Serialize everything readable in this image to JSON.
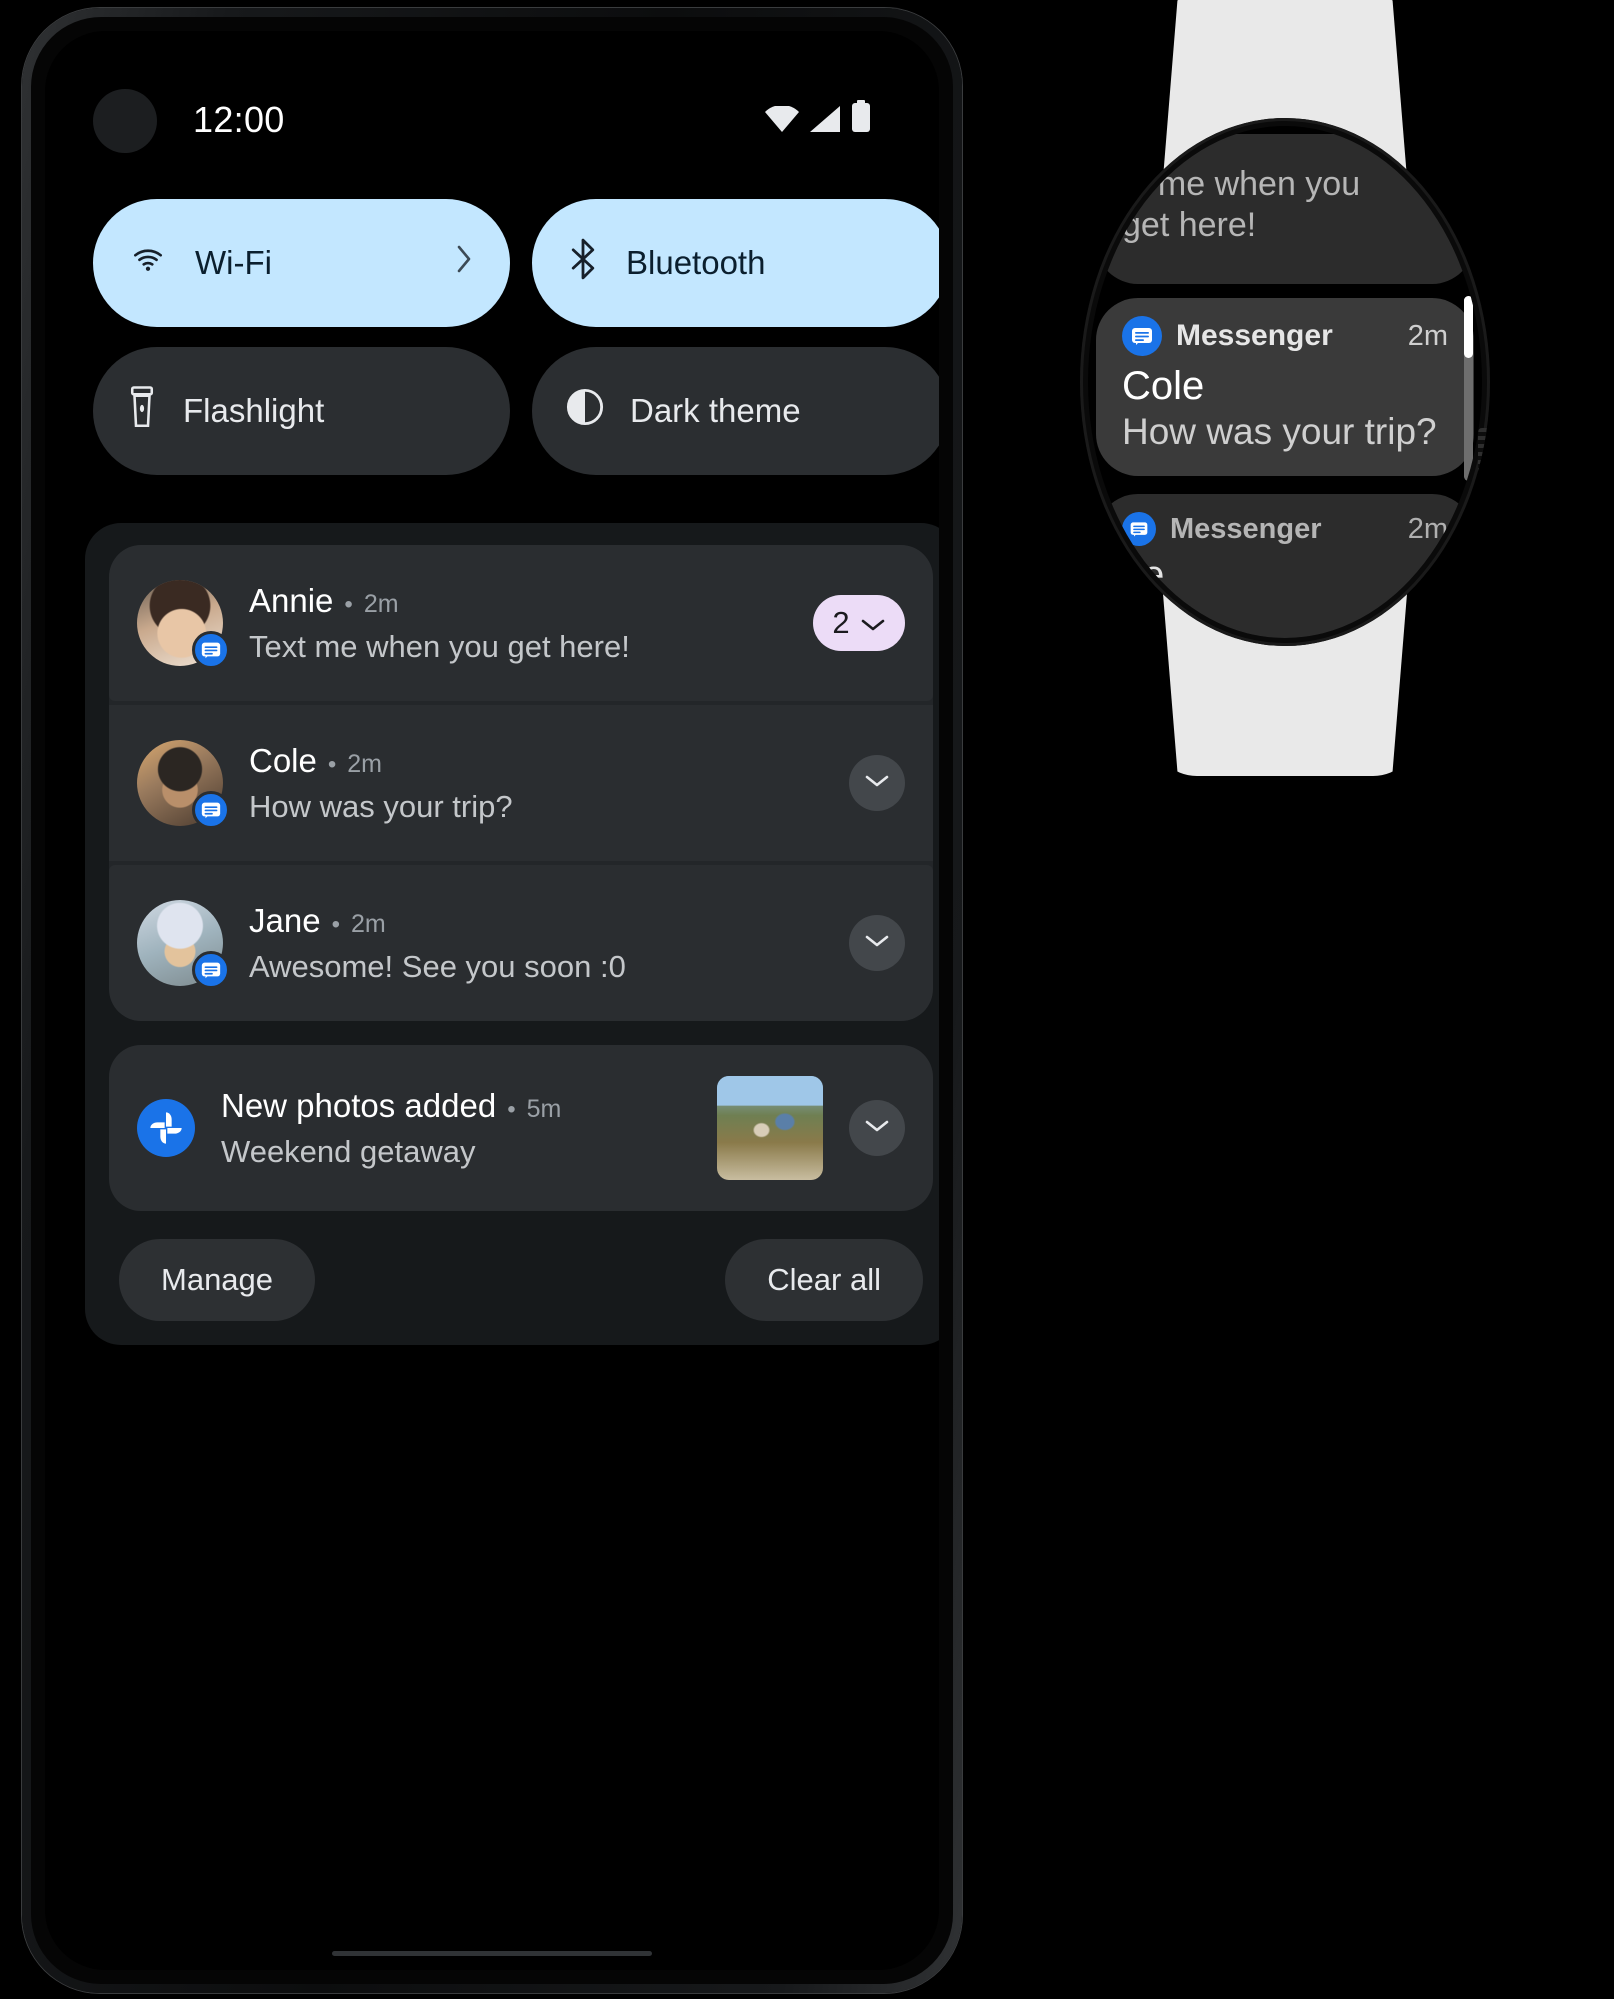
{
  "phone": {
    "status_bar": {
      "time": "12:00",
      "icons": [
        "wifi-icon",
        "cell-signal-icon",
        "battery-icon"
      ]
    },
    "quick_tiles": [
      {
        "label": "Wi-Fi",
        "icon": "wifi-icon",
        "state": "on",
        "has_chevron": true
      },
      {
        "label": "Bluetooth",
        "icon": "bluetooth-icon",
        "state": "on",
        "has_chevron": false
      },
      {
        "label": "Flashlight",
        "icon": "flashlight-icon",
        "state": "off",
        "has_chevron": false
      },
      {
        "label": "Dark theme",
        "icon": "dark-theme-icon",
        "state": "off",
        "has_chevron": false
      }
    ],
    "notifications": [
      {
        "name": "Annie",
        "separator": "•",
        "time": "2m",
        "text": "Text me when you get here!",
        "app_icon": "messenger-icon",
        "avatar": "annie-avatar",
        "count": "2",
        "control": "count-badge"
      },
      {
        "name": "Cole",
        "separator": "•",
        "time": "2m",
        "text": "How was your trip?",
        "app_icon": "messenger-icon",
        "avatar": "cole-avatar",
        "control": "expand-chevron"
      },
      {
        "name": "Jane",
        "separator": "•",
        "time": "2m",
        "text": "Awesome! See you soon :0",
        "app_icon": "messenger-icon",
        "avatar": "jane-avatar",
        "control": "expand-chevron"
      }
    ],
    "photos_notification": {
      "title": "New photos added",
      "separator": "•",
      "time": "5m",
      "text": "Weekend getaway",
      "app_icon": "google-photos-icon",
      "thumbnail": "weekend-getaway-thumbnail",
      "control": "expand-chevron"
    },
    "actions": {
      "manage_label": "Manage",
      "clear_all_label": "Clear all"
    }
  },
  "watch": {
    "cards": [
      {
        "id": "partial-top",
        "text": "Text me when you get here!",
        "visible_text": "xt me when you\nget here!"
      },
      {
        "id": "focused",
        "app": "Messenger",
        "time": "2m",
        "title": "Cole",
        "body": "How was your trip?",
        "app_icon": "messenger-icon"
      },
      {
        "id": "partial-bottom",
        "app": "Messenger",
        "time": "2m",
        "title": "ne",
        "app_icon": "messenger-icon"
      }
    ],
    "hardware": {
      "crown": "rotating-crown",
      "band_color": "#e9e9e9"
    }
  },
  "colors": {
    "tile_on_bg": "#c3e7ff",
    "tile_off_bg": "#2b2e31",
    "notif_bg": "#2a2d30",
    "shade_bg": "#16191b",
    "count_badge_bg": "#ecdcf7",
    "messenger_blue": "#1a73e8",
    "power_button": "#dcdea4"
  }
}
